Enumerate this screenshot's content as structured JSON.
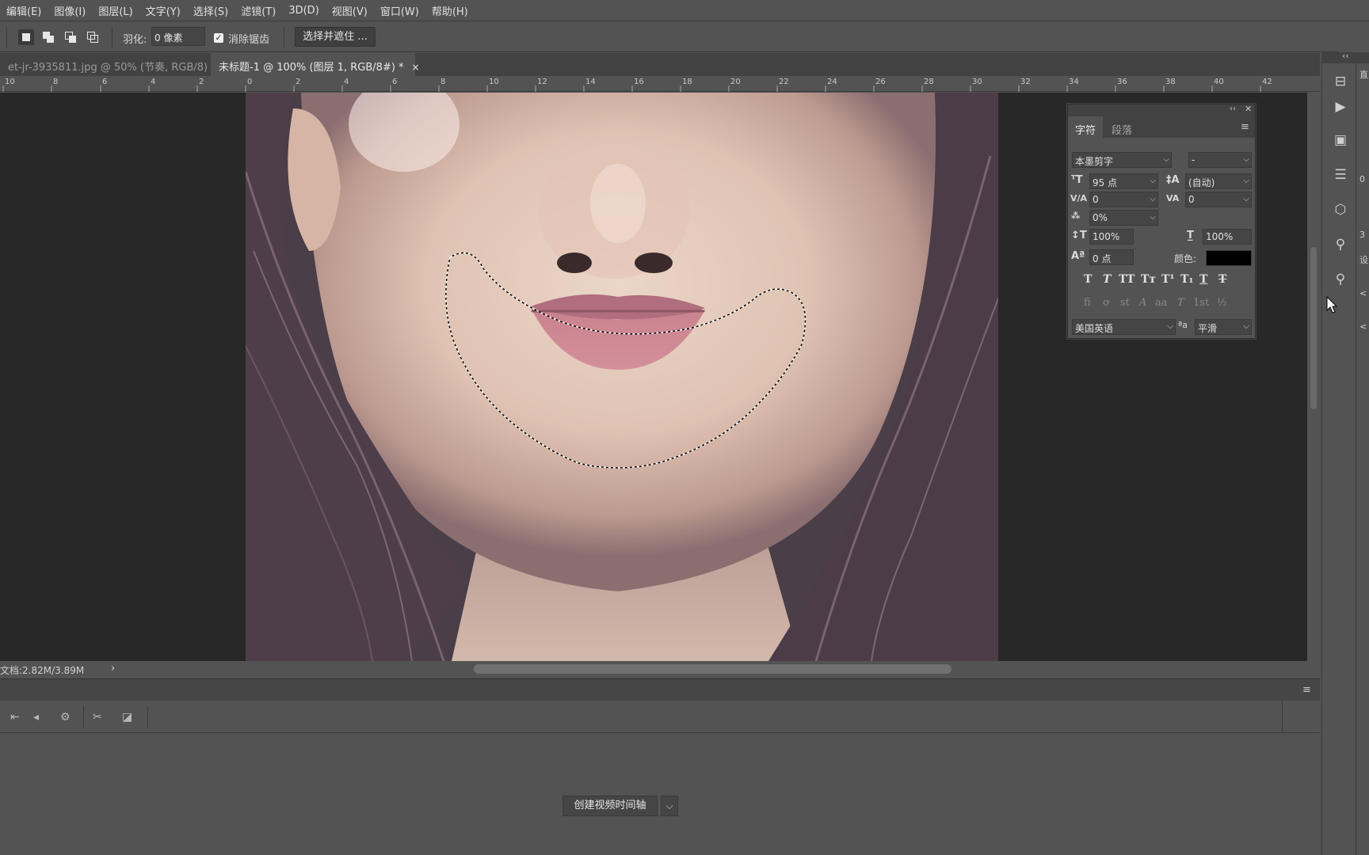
{
  "menu": [
    "编辑(E)",
    "图像(I)",
    "图层(L)",
    "文字(Y)",
    "选择(S)",
    "滤镜(T)",
    "3D(D)",
    "视图(V)",
    "窗口(W)",
    "帮助(H)"
  ],
  "options": {
    "feather_label": "羽化:",
    "feather_value": "0 像素",
    "antialias_label": "消除锯齿",
    "antialias_checked": true,
    "select_mask_label": "选择并遮住 ..."
  },
  "tabs": [
    {
      "label": "et-jr-3935811.jpg @ 50% (节奏, RGB/8) *",
      "close": "×",
      "active": false
    },
    {
      "label": "未标题-1 @ 100% (图层 1, RGB/8#) *",
      "close": "×",
      "active": true
    }
  ],
  "ruler": {
    "left_labels": [
      "10",
      "8",
      "6",
      "4",
      "2"
    ],
    "right_labels": [
      "0",
      "2",
      "4",
      "6",
      "8",
      "10",
      "12",
      "14",
      "16",
      "18",
      "20",
      "22",
      "24",
      "26",
      "28",
      "30",
      "32",
      "34",
      "36",
      "38",
      "40",
      "42"
    ]
  },
  "status": {
    "doc_info": "文档:2.82M/3.89M",
    "arrow": "›"
  },
  "timeline": {
    "create_label": "创建视频时间轴",
    "dropdown_glyph": "⌵"
  },
  "char_panel": {
    "tab_character": "字符",
    "tab_paragraph": "段落",
    "font_family": "本墨剪字",
    "font_style": "-",
    "font_size": "95 点",
    "leading": "(自动)",
    "kerning": "0",
    "tracking": "0",
    "tsume": "0%",
    "vertical_scale": "100%",
    "horizontal_scale": "100%",
    "baseline_shift": "0 点",
    "color_label": "颜色:",
    "text_color": "#000000",
    "language": "美国英语",
    "aa_icon_text": "ªa",
    "antialias_method": "平滑",
    "style_buttons": [
      "T",
      "T",
      "TT",
      "Tᴛ",
      "T¹",
      "T₁",
      "T",
      "T"
    ],
    "opentype_buttons": [
      "fi",
      "ơ",
      "st",
      "A",
      "aa",
      "T",
      "1st",
      "½"
    ]
  },
  "dock2": [
    "直",
    "0",
    "3",
    "设",
    "<",
    "<"
  ]
}
